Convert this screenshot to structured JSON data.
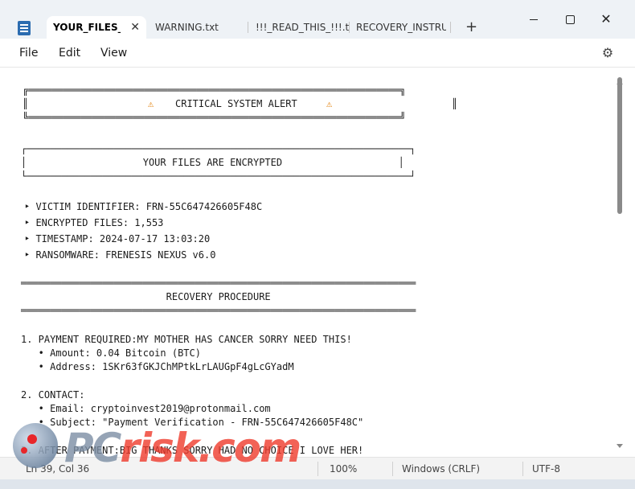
{
  "window": {
    "tabs": [
      {
        "label": "YOUR_FILES_A",
        "active": true
      },
      {
        "label": "WARNING.txt",
        "active": false
      },
      {
        "label": "!!!_READ_THIS_!!!.txt",
        "active": false
      },
      {
        "label": "RECOVERY_INSTRUCT",
        "active": false
      }
    ],
    "close_tab_glyph": "✕",
    "new_tab_glyph": "+",
    "close_glyph": "✕"
  },
  "menu": {
    "file": "File",
    "edit": "Edit",
    "view": "View",
    "settings_glyph": "⚙"
  },
  "document": {
    "alert_top": "╔════════════════════════════════════════════════════════════════╗",
    "alert_mid_left": "║",
    "alert_icon": "⚠",
    "alert_title": "CRITICAL SYSTEM ALERT",
    "alert_mid_right": "║",
    "alert_bottom": "╚════════════════════════════════════════════════════════════════╝",
    "enc_top": "┌──────────────────────────────────────────────────────────────────┐",
    "enc_mid": "│                    YOUR FILES ARE ENCRYPTED                    │",
    "enc_bottom": "└──────────────────────────────────────────────────────────────────┘",
    "info": [
      "‣ VICTIM IDENTIFIER: FRN-55C647426605F48C",
      "‣ ENCRYPTED FILES: 1,553",
      "‣ TIMESTAMP: 2024-07-17 13:03:20",
      "‣ RANSOMWARE: FRENESIS NEXUS v6.0"
    ],
    "rule": "════════════════════════════════════════════════════════════════════",
    "procedure_title": "                         RECOVERY PROCEDURE",
    "payment_header": "1. PAYMENT REQUIRED:MY MOTHER HAS CANCER SORRY NEED THIS!",
    "payment_amount": "   • Amount: 0.04 Bitcoin (BTC)",
    "payment_address": "   • Address: 1SKr63fGKJChMPtkLrLAUGpF4gLcGYadM",
    "contact_header": "2. CONTACT:",
    "contact_email": "   • Email: cryptoinvest2019@protonmail.com",
    "contact_subject": "   • Subject: \"Payment Verification - FRN-55C647426605F48C\"",
    "after_payment": "3. AFTER PAYMENT:BIG THANKS SORRY HAD NO CHOICE I LOVE HER!"
  },
  "status": {
    "position": "Ln 39, Col 36",
    "zoom": "100%",
    "line_ending": "Windows (CRLF)",
    "encoding": "UTF-8"
  },
  "watermark": {
    "pc": "PC",
    "risk": "risk.com"
  }
}
